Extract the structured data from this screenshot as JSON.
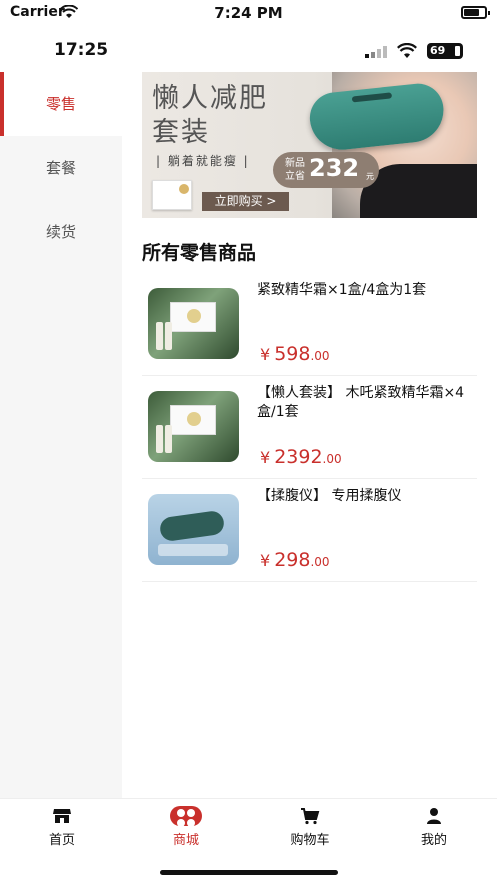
{
  "sim_status": {
    "carrier": "Carrier",
    "time": "7:24 PM"
  },
  "app_status": {
    "time": "17:25",
    "battery": "69"
  },
  "sidebar": {
    "items": [
      {
        "label": "零售",
        "active": true
      },
      {
        "label": "套餐",
        "active": false
      },
      {
        "label": "续货",
        "active": false
      }
    ]
  },
  "banner": {
    "headline_line1": "懒人减肥",
    "headline_line2": "套装",
    "subtitle": "| 躺着就能瘦 |",
    "badge_label": "新品立省",
    "badge_price": "232",
    "badge_unit": "元",
    "cta": "立即购买 >"
  },
  "section_title": "所有零售商品",
  "products": [
    {
      "name": "紧致精华霜×1盒/4盒为1套",
      "currency": "¥",
      "price": "598",
      "cents": ".00",
      "thumb": "green-box"
    },
    {
      "name": "【懒人套装】 木吒紧致精华霜×4盒/1套",
      "currency": "¥",
      "price": "2392",
      "cents": ".00",
      "thumb": "green-box"
    },
    {
      "name": "【揉腹仪】 专用揉腹仪",
      "currency": "¥",
      "price": "298",
      "cents": ".00",
      "thumb": "blue-device"
    }
  ],
  "tabbar": {
    "tabs": [
      {
        "label": "首页",
        "icon": "store-icon",
        "active": false
      },
      {
        "label": "商城",
        "icon": "mall-icon",
        "active": true
      },
      {
        "label": "购物车",
        "icon": "cart-icon",
        "active": false
      },
      {
        "label": "我的",
        "icon": "user-icon",
        "active": false
      }
    ]
  },
  "colors": {
    "accent": "#c9302c",
    "sidebar_bg": "#f6f6f6"
  }
}
